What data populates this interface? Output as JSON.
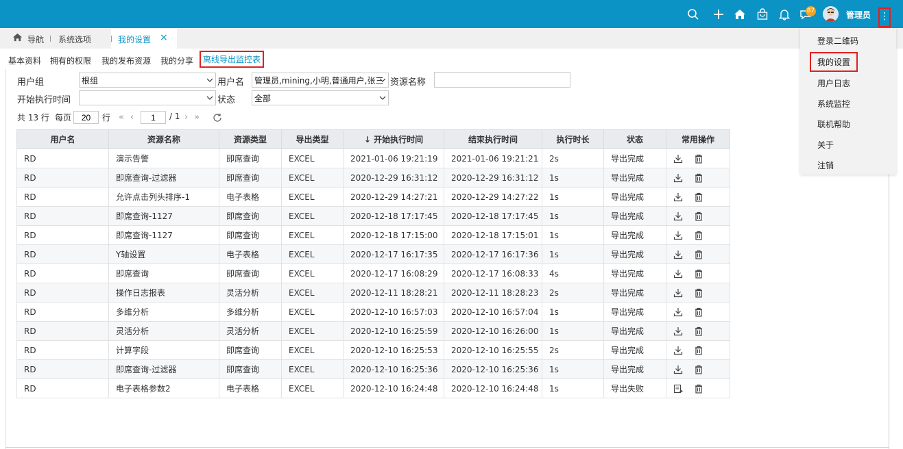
{
  "topbar": {
    "notif_count": "87",
    "username": "管理员",
    "icons": [
      "search-icon",
      "plus-icon",
      "home-icon",
      "bag-icon",
      "bell-icon",
      "chat-icon",
      "more-icon"
    ],
    "bg_color": "#0b93c6"
  },
  "tabs": {
    "nav_label": "导航",
    "system_label": "系统选项",
    "active_label": "我的设置",
    "close": "×"
  },
  "subtabs": [
    "基本资料",
    "拥有的权限",
    "我的发布资源",
    "我的分享",
    "离线导出监控表"
  ],
  "filters": {
    "group_label": "用户组",
    "group_value": "根组",
    "user_label": "用户名",
    "user_value": "管理员,mining,小明,普通用户,张三",
    "resource_label": "资源名称",
    "resource_value": "",
    "start_label": "开始执行时间",
    "start_value": "",
    "status_label": "状态",
    "status_value": "全部"
  },
  "pager": {
    "total": "共 13 行",
    "per_page_label": "每页",
    "per_page": "20",
    "row_label": "行",
    "page": "1",
    "page_total": "/ 1"
  },
  "table": {
    "headers": [
      "用户名",
      "资源名称",
      "资源类型",
      "导出类型",
      "开始执行时间",
      "结束执行时间",
      "执行时长",
      "状态",
      "常用操作"
    ],
    "sort_arrow": "↓",
    "rows": [
      [
        "RD",
        "演示告警",
        "即席查询",
        "EXCEL",
        "2021-01-06  19:21:19",
        "2021-01-06  19:21:21",
        "2s",
        "导出完成"
      ],
      [
        "RD",
        "即席查询-过滤器",
        "即席查询",
        "EXCEL",
        "2020-12-29  16:31:12",
        "2020-12-29  16:31:12",
        "1s",
        "导出完成"
      ],
      [
        "RD",
        "允许点击列头排序-1",
        "电子表格",
        "EXCEL",
        "2020-12-29  14:27:21",
        "2020-12-29  14:27:22",
        "1s",
        "导出完成"
      ],
      [
        "RD",
        "即席查询-1127",
        "即席查询",
        "EXCEL",
        "2020-12-18  17:17:45",
        "2020-12-18  17:17:45",
        "1s",
        "导出完成"
      ],
      [
        "RD",
        "即席查询-1127",
        "即席查询",
        "EXCEL",
        "2020-12-18  17:15:00",
        "2020-12-18  17:15:01",
        "1s",
        "导出完成"
      ],
      [
        "RD",
        "Y轴设置",
        "电子表格",
        "EXCEL",
        "2020-12-17  16:17:35",
        "2020-12-17  16:17:36",
        "1s",
        "导出完成"
      ],
      [
        "RD",
        "即席查询",
        "即席查询",
        "EXCEL",
        "2020-12-17  16:08:29",
        "2020-12-17  16:08:33",
        "4s",
        "导出完成"
      ],
      [
        "RD",
        "操作日志报表",
        "灵活分析",
        "EXCEL",
        "2020-12-11  18:28:21",
        "2020-12-11  18:28:23",
        "2s",
        "导出完成"
      ],
      [
        "RD",
        "多维分析",
        "多维分析",
        "EXCEL",
        "2020-12-10  16:57:03",
        "2020-12-10  16:57:04",
        "1s",
        "导出完成"
      ],
      [
        "RD",
        "灵活分析",
        "灵活分析",
        "EXCEL",
        "2020-12-10  16:25:59",
        "2020-12-10  16:26:00",
        "1s",
        "导出完成"
      ],
      [
        "RD",
        "计算字段",
        "即席查询",
        "EXCEL",
        "2020-12-10  16:25:53",
        "2020-12-10  16:25:55",
        "2s",
        "导出完成"
      ],
      [
        "RD",
        "即席查询-过滤器",
        "即席查询",
        "EXCEL",
        "2020-12-10  16:25:36",
        "2020-12-10  16:25:36",
        "1s",
        "导出完成"
      ],
      [
        "RD",
        "电子表格参数2",
        "电子表格",
        "EXCEL",
        "2020-12-10  16:24:48",
        "2020-12-10  16:24:48",
        "1s",
        "导出失败"
      ]
    ]
  },
  "menu": [
    "登录二维码",
    "我的设置",
    "用户日志",
    "系统监控",
    "联机帮助",
    "关于",
    "注销"
  ]
}
